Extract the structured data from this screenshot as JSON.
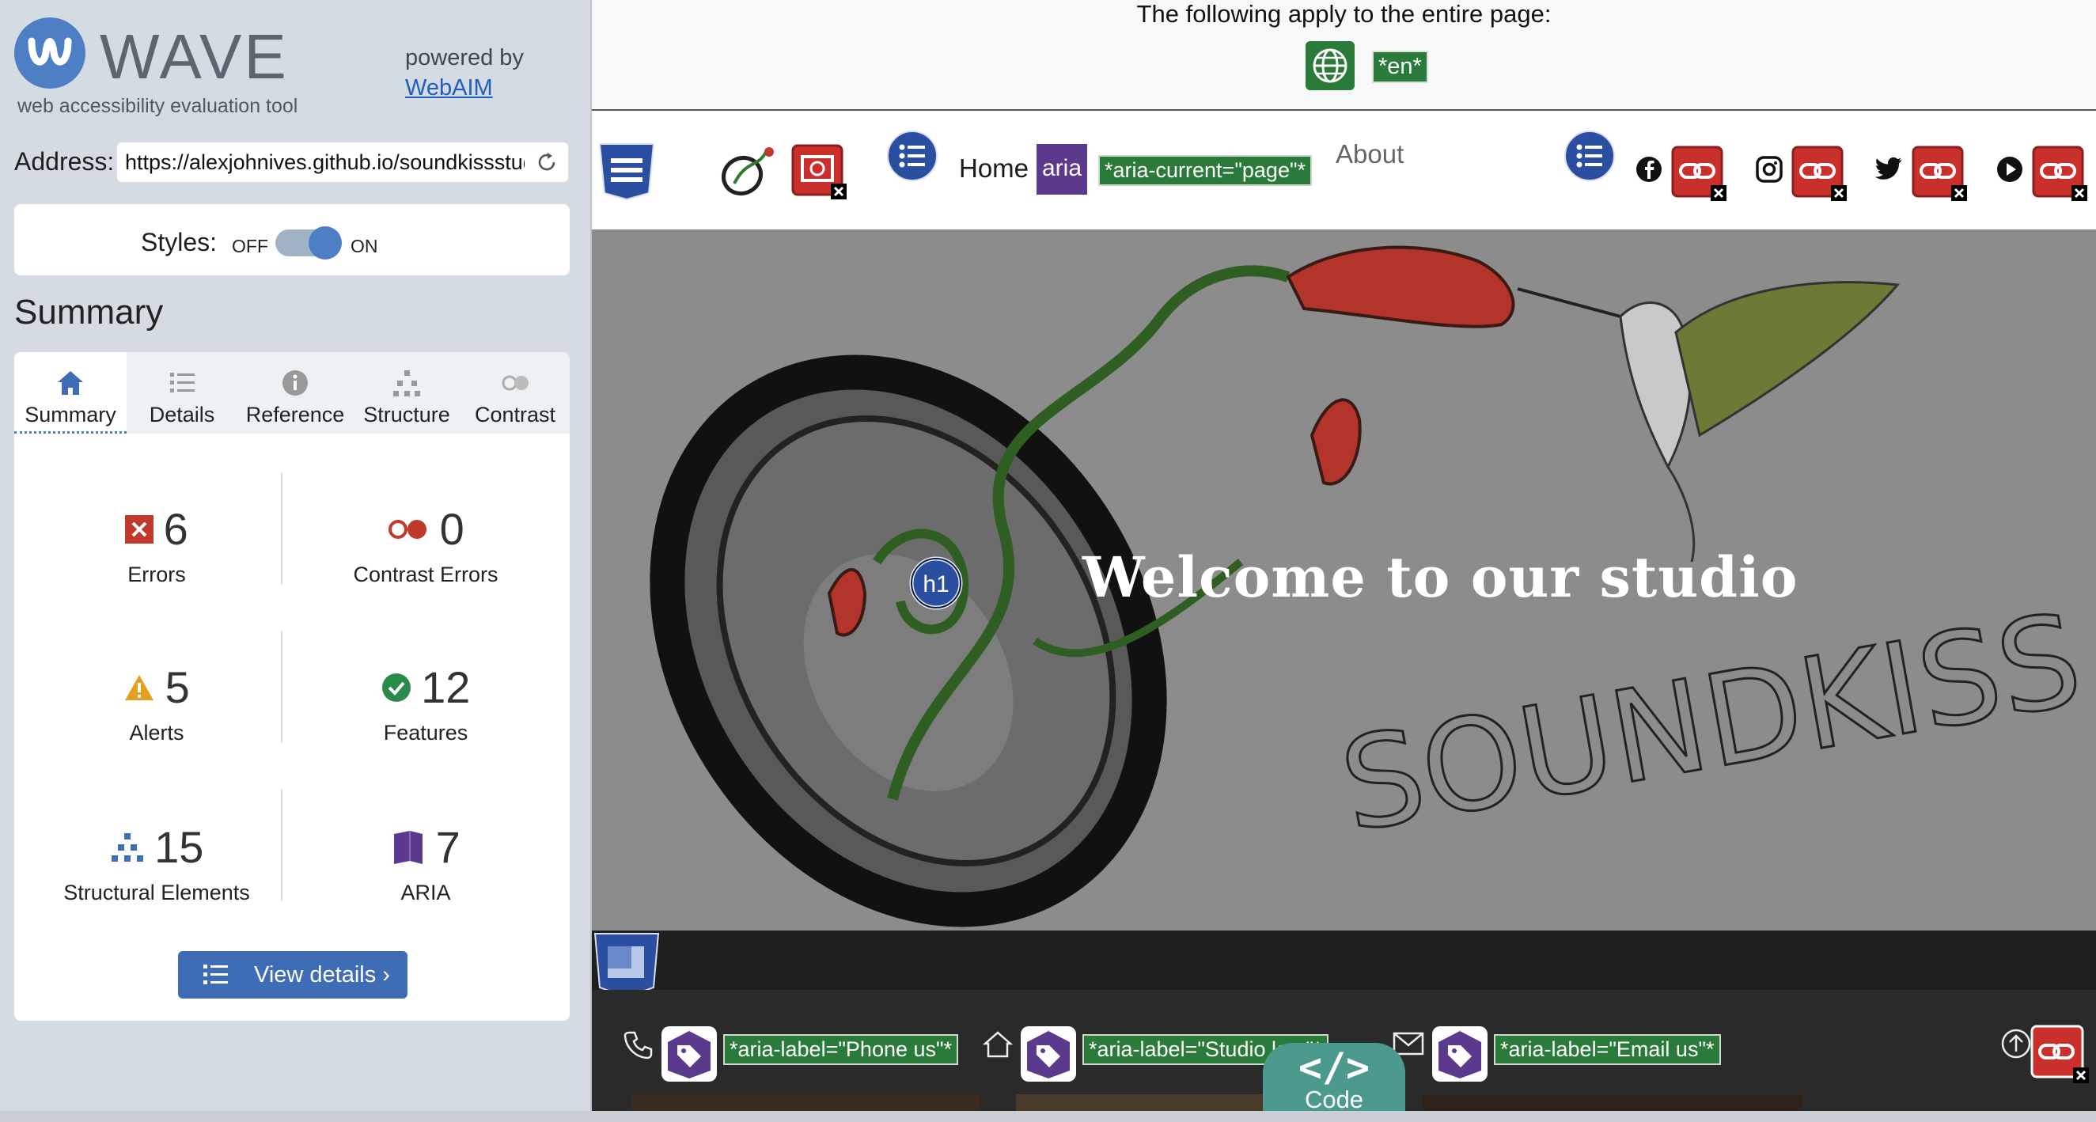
{
  "app": {
    "name": "WAVE",
    "tagline": "web accessibility evaluation tool",
    "powered_by": "powered by",
    "powered_link": "WebAIM"
  },
  "address": {
    "label": "Address:",
    "value": "https://alexjohnives.github.io/soundkissstudio"
  },
  "styles": {
    "label": "Styles:",
    "off": "OFF",
    "on": "ON",
    "state": "on"
  },
  "summary": {
    "heading": "Summary",
    "tabs": [
      {
        "label": "Summary",
        "icon": "home-icon",
        "active": true
      },
      {
        "label": "Details",
        "icon": "list-icon",
        "active": false
      },
      {
        "label": "Reference",
        "icon": "info-icon",
        "active": false
      },
      {
        "label": "Structure",
        "icon": "hierarchy-icon",
        "active": false
      },
      {
        "label": "Contrast",
        "icon": "contrast-icon",
        "active": false
      }
    ],
    "stats": {
      "errors": {
        "value": "6",
        "label": "Errors",
        "color": "#c0392b"
      },
      "contrast_errors": {
        "value": "0",
        "label": "Contrast Errors",
        "color": "#c0392b"
      },
      "alerts": {
        "value": "5",
        "label": "Alerts",
        "color": "#e6a020"
      },
      "features": {
        "value": "12",
        "label": "Features",
        "color": "#2a8a4a"
      },
      "structural": {
        "value": "15",
        "label": "Structural Elements",
        "color": "#3e6db5"
      },
      "aria": {
        "value": "7",
        "label": "ARIA",
        "color": "#5b3a8e"
      }
    },
    "view_details": "View details ›"
  },
  "page_note": {
    "text": "The following apply to the entire page:",
    "lang_tag": "*en*"
  },
  "nav": {
    "home": "Home",
    "aria_badge": "aria",
    "aria_current": "*aria-current=\"page\"*",
    "about": "About"
  },
  "hero": {
    "heading_badge": "h1",
    "title": "Welcome to our studio",
    "logo_text": "SOUNDKISS"
  },
  "footer": {
    "phone_label": "*aria-label=\"Phone us\"*",
    "studio_label": "*aria-label=\"Studio lo...\"*",
    "email_label": "*aria-label=\"Email us\"*"
  },
  "code_tab": {
    "glyph": "</>",
    "label": "Code"
  },
  "colors": {
    "accent": "#4e7ec4",
    "sidebar_bg": "#d4dbe2",
    "error_red": "#c0392b",
    "feature_green": "#2a7a3a",
    "aria_purple": "#5b3a8e",
    "code_teal": "#4c9a8e"
  }
}
